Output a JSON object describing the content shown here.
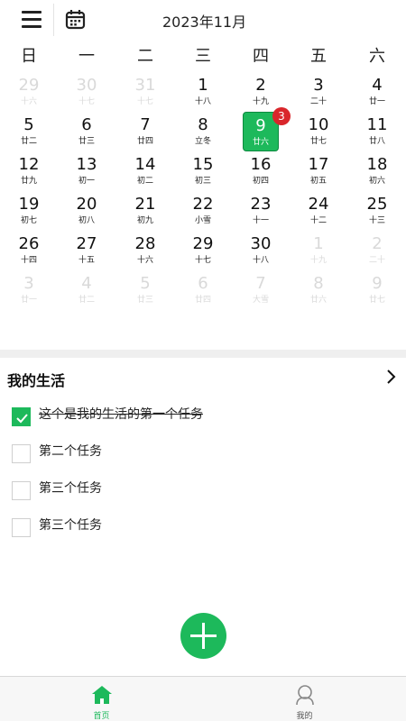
{
  "header": {
    "month_title": "2023年11月"
  },
  "weekdays": [
    "日",
    "一",
    "二",
    "三",
    "四",
    "五",
    "六"
  ],
  "calendar": {
    "weeks": [
      [
        {
          "d": "29",
          "l": "十六",
          "o": true
        },
        {
          "d": "30",
          "l": "十七",
          "o": true
        },
        {
          "d": "31",
          "l": "十七",
          "o": true
        },
        {
          "d": "1",
          "l": "十八"
        },
        {
          "d": "2",
          "l": "十九"
        },
        {
          "d": "3",
          "l": "二十"
        },
        {
          "d": "4",
          "l": "廿一"
        }
      ],
      [
        {
          "d": "5",
          "l": "廿二"
        },
        {
          "d": "6",
          "l": "廿三"
        },
        {
          "d": "7",
          "l": "廿四"
        },
        {
          "d": "8",
          "l": "立冬"
        },
        {
          "d": "9",
          "l": "廿六",
          "today": true
        },
        {
          "d": "10",
          "l": "廿七"
        },
        {
          "d": "11",
          "l": "廿八"
        }
      ],
      [
        {
          "d": "12",
          "l": "廿九"
        },
        {
          "d": "13",
          "l": "初一"
        },
        {
          "d": "14",
          "l": "初二"
        },
        {
          "d": "15",
          "l": "初三"
        },
        {
          "d": "16",
          "l": "初四"
        },
        {
          "d": "17",
          "l": "初五"
        },
        {
          "d": "18",
          "l": "初六"
        }
      ],
      [
        {
          "d": "19",
          "l": "初七"
        },
        {
          "d": "20",
          "l": "初八"
        },
        {
          "d": "21",
          "l": "初九"
        },
        {
          "d": "22",
          "l": "小雪"
        },
        {
          "d": "23",
          "l": "十一"
        },
        {
          "d": "24",
          "l": "十二"
        },
        {
          "d": "25",
          "l": "十三"
        }
      ],
      [
        {
          "d": "26",
          "l": "十四"
        },
        {
          "d": "27",
          "l": "十五"
        },
        {
          "d": "28",
          "l": "十六"
        },
        {
          "d": "29",
          "l": "十七"
        },
        {
          "d": "30",
          "l": "十八"
        },
        {
          "d": "1",
          "l": "十九",
          "o": true
        },
        {
          "d": "2",
          "l": "二十",
          "o": true
        }
      ],
      [
        {
          "d": "3",
          "l": "廿一",
          "o": true
        },
        {
          "d": "4",
          "l": "廿二",
          "o": true
        },
        {
          "d": "5",
          "l": "廿三",
          "o": true
        },
        {
          "d": "6",
          "l": "廿四",
          "o": true
        },
        {
          "d": "7",
          "l": "大雪",
          "o": true
        },
        {
          "d": "8",
          "l": "廿六",
          "o": true
        },
        {
          "d": "9",
          "l": "廿七",
          "o": true
        }
      ]
    ],
    "today_badge": "3"
  },
  "list": {
    "title": "我的生活",
    "tasks": [
      {
        "text": "这个是我的生活的第一个任务",
        "done": true
      },
      {
        "text": "第二个任务",
        "done": false
      },
      {
        "text": "第三个任务",
        "done": false
      },
      {
        "text": "第三个任务",
        "done": false
      }
    ]
  },
  "tabs": [
    {
      "label": "首页",
      "icon": "home-icon",
      "active": true
    },
    {
      "label": "我的",
      "icon": "user-icon",
      "active": false
    }
  ],
  "colors": {
    "accent": "#1db95b",
    "badge": "#d9262b",
    "muted": "#d9d9d9"
  }
}
